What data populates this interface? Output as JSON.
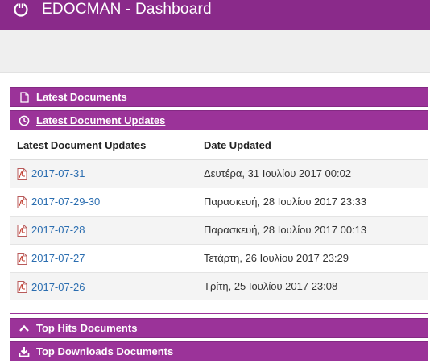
{
  "header": {
    "title": "EDOCMAN - Dashboard"
  },
  "panels": {
    "latest_documents": "Latest Documents",
    "latest_updates": "Latest Document Updates",
    "top_hits": "Top Hits Documents",
    "top_downloads": "Top Downloads Documents"
  },
  "table": {
    "headers": [
      "Latest Document Updates",
      "Date Updated"
    ],
    "rows": [
      {
        "name": "2017-07-31",
        "date": "Δευτέρα, 31 Ιουλίου 2017 00:02"
      },
      {
        "name": "2017-07-29-30",
        "date": "Παρασκευή, 28 Ιουλίου 2017 23:33"
      },
      {
        "name": "2017-07-28",
        "date": "Παρασκευή, 28 Ιουλίου 2017 00:13"
      },
      {
        "name": "2017-07-27",
        "date": "Τετάρτη, 26 Ιουλίου 2017 23:29"
      },
      {
        "name": "2017-07-26",
        "date": "Τρίτη, 25 Ιουλίου 2017 23:08"
      }
    ]
  },
  "colors": {
    "brand": "#8a2a8a",
    "panel": "#9b3399",
    "link": "#2a6db0"
  },
  "icons": {
    "logo": "power-icon",
    "latest_documents": "file-icon",
    "latest_updates": "clock-icon",
    "top_hits": "chevron-up-icon",
    "top_downloads": "download-icon",
    "row": "pdf-icon"
  }
}
